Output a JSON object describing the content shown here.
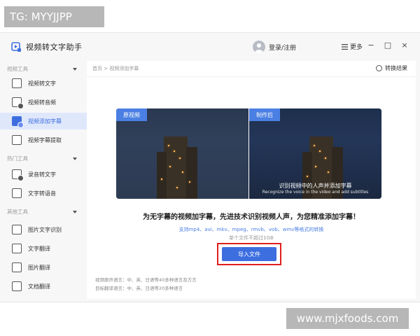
{
  "watermarks": {
    "top": "TG: MYYJJPP",
    "bottom": "www.mjxfoods.com"
  },
  "app": {
    "title": "视频转文字助手",
    "login": "登录/注册",
    "more": "更多"
  },
  "window_controls": [
    "−",
    "□",
    "×"
  ],
  "sidebar": {
    "sections": [
      {
        "title": "视频工具",
        "items": [
          {
            "label": "视频转文字",
            "active": false
          },
          {
            "label": "视频转音频",
            "active": false
          },
          {
            "label": "视频添加字幕",
            "active": true
          },
          {
            "label": "视频字幕提取",
            "active": false
          }
        ]
      },
      {
        "title": "热门工具",
        "items": [
          {
            "label": "录音转文字",
            "active": false
          },
          {
            "label": "文字转语音",
            "active": false
          }
        ]
      },
      {
        "title": "其他工具",
        "items": [
          {
            "label": "图片文字识别",
            "active": false
          },
          {
            "label": "文字翻译",
            "active": false
          },
          {
            "label": "图片翻译",
            "active": false
          },
          {
            "label": "文档翻译",
            "active": false
          }
        ]
      }
    ]
  },
  "main": {
    "breadcrumb": "首页 > 视频添加字幕",
    "top_right_button": "转换结果",
    "preview": {
      "before_label": "原视频",
      "after_label": "制作后",
      "subtitle_cn": "识别视频中的人声并添加字幕",
      "subtitle_en": "Recognize the voice in the video and add subtitles"
    },
    "headline": "为无字幕的视频加字幕，先进技术识别视频人声，为您精准添加字幕！",
    "formats": "支持mp4、avi、mkv、mpeg、rmvb、vob、wmv等格式的转换",
    "size_limit": "单个文件不超过1GB",
    "import_button": "导入文件",
    "footer_lines": [
      "视频原声语言：中、英、日语等40多种语言及方言",
      "目标翻译语言：中、英、日语等20多种语言"
    ]
  },
  "colors": {
    "accent": "#3d6ee0",
    "highlight": "#e02020"
  }
}
